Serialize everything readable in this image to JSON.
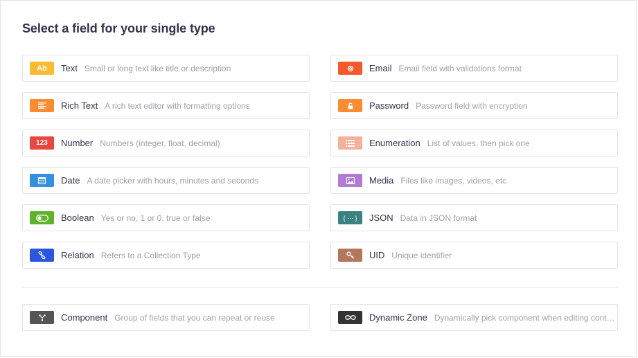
{
  "dialog": {
    "title": "Select a field for your single type"
  },
  "fields_left": [
    {
      "label": "Text",
      "description": "Small or long text like title or description",
      "icon": "text-icon",
      "color": "#FABB33"
    },
    {
      "label": "Rich Text",
      "description": "A rich text editor with formatting options",
      "icon": "rich-text-icon",
      "color": "#FA8C33"
    },
    {
      "label": "Number",
      "description": "Numbers (integer, float, decimal)",
      "icon": "number-icon",
      "color": "#E8483F"
    },
    {
      "label": "Date",
      "description": "A date picker with hours, minutes and seconds",
      "icon": "calendar-icon",
      "color": "#3590E0"
    },
    {
      "label": "Boolean",
      "description": "Yes or no, 1 or 0, true or false",
      "icon": "toggle-icon",
      "color": "#5FB32A"
    },
    {
      "label": "Relation",
      "description": "Refers to a Collection Type",
      "icon": "link-icon",
      "color": "#2B56DF"
    }
  ],
  "fields_right": [
    {
      "label": "Email",
      "description": "Email field with validations format",
      "icon": "at-sign-icon",
      "color": "#F3592A"
    },
    {
      "label": "Password",
      "description": "Password field with encryption",
      "icon": "lock-icon",
      "color": "#FA8C33"
    },
    {
      "label": "Enumeration",
      "description": "List of values, then pick one",
      "icon": "list-icon",
      "color": "#F4B19B"
    },
    {
      "label": "Media",
      "description": "Files like images, videos, etc",
      "icon": "image-icon",
      "color": "#B27BD6"
    },
    {
      "label": "JSON",
      "description": "Data in JSON format",
      "icon": "braces-icon",
      "color": "#398281"
    },
    {
      "label": "UID",
      "description": "Unique identifier",
      "icon": "key-icon",
      "color": "#B5775B"
    }
  ],
  "special": [
    {
      "label": "Component",
      "description": "Group of fields that you can repeat or reuse",
      "icon": "component-icon",
      "color": "#555555"
    },
    {
      "label": "Dynamic Zone",
      "description": "Dynamically pick component when editing content",
      "icon": "infinity-icon",
      "color": "#333333"
    }
  ],
  "icon_text": {
    "text": "Ab",
    "number": "123",
    "json": "{ ··· }"
  }
}
